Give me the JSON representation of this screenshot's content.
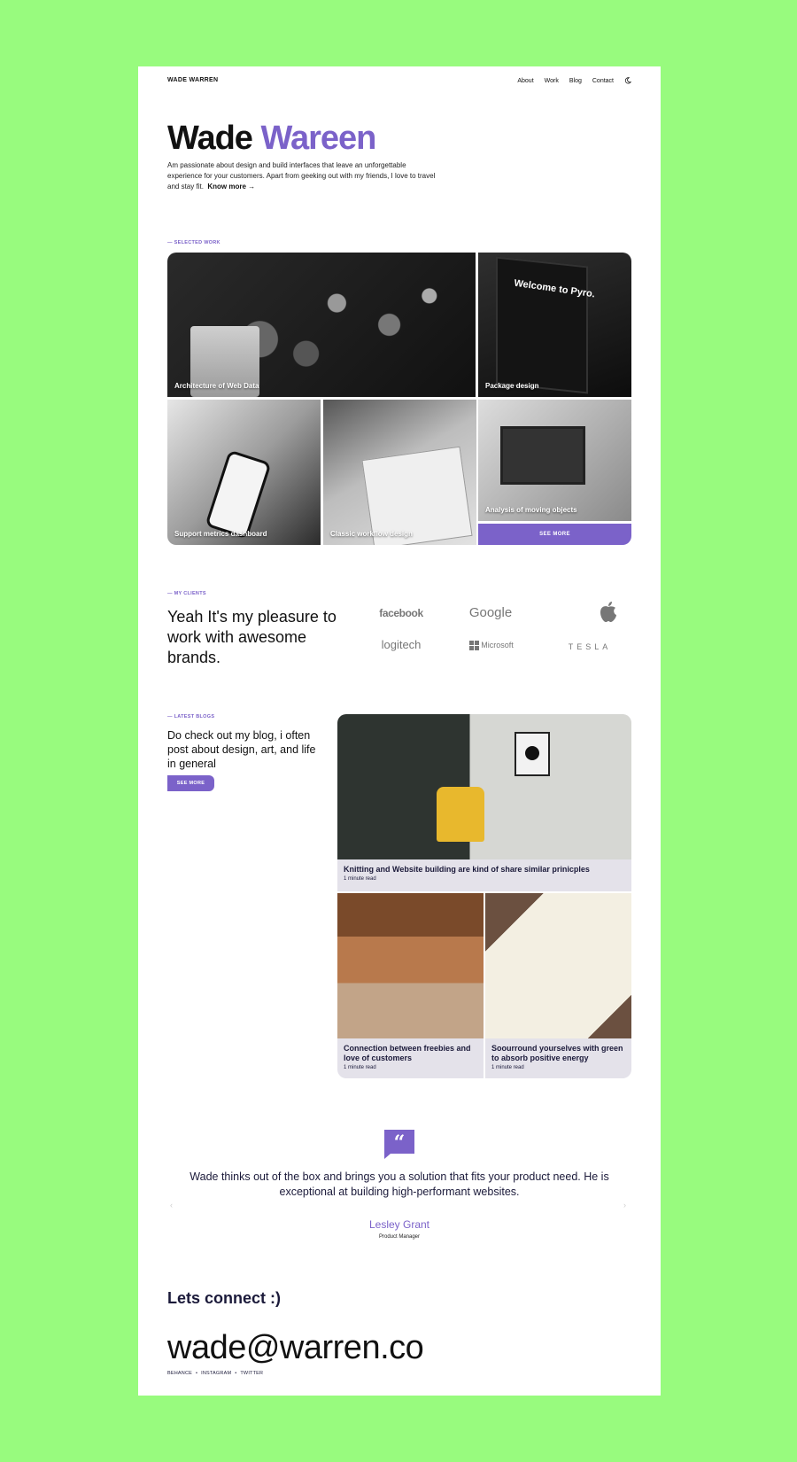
{
  "header": {
    "brand": "WADE WARREN",
    "nav": [
      "About",
      "Work",
      "Blog",
      "Contact"
    ],
    "theme_toggle_icon": "moon-icon"
  },
  "hero": {
    "first_name": "Wade",
    "last_name": "Wareen",
    "bio": "Am passionate about design and build interfaces that leave an unforgettable experience for your customers. Apart from geeking out with my friends, I love to travel and stay fit.",
    "know_more": "Know more →"
  },
  "work": {
    "label": "— SELECTED WORK",
    "items": [
      "Architecture of Web Data",
      "Package design",
      "Support metrics dashboard",
      "Classic workflow design",
      "Analysis of moving objects"
    ],
    "see_more": "SEE MORE",
    "pyro_screen_text": "Welcome to Pyro."
  },
  "clients": {
    "label": "— MY CLIENTS",
    "heading": "Yeah It's my pleasure to work with awesome brands.",
    "logos": [
      "facebook",
      "Google",
      "apple-logo-icon",
      "logitech",
      "Microsoft",
      "TESLA"
    ]
  },
  "blog": {
    "label": "— LATEST BLOGS",
    "heading": "Do check out my blog, i often post about design, art, and life in general",
    "see_more": "SEE MORE",
    "posts": [
      {
        "title": "Knitting and Website building are kind of share similar prinicples",
        "read": "1 minute read"
      },
      {
        "title": "Connection between freebies and love of customers",
        "read": "1 minute read"
      },
      {
        "title": "Soourround yourselves with green to absorb positive energy",
        "read": "1 minute read"
      }
    ]
  },
  "testimonial": {
    "quote_mark": "“",
    "text": "Wade thinks out of the box and brings you a solution that fits your product need. He is exceptional at building high-performant websites.",
    "author": "Lesley Grant",
    "role": "Product Manager",
    "prev": "‹",
    "next": "›"
  },
  "contact": {
    "heading": "Lets connect :)",
    "email": "wade@warren.co",
    "socials": [
      "BEHANCE",
      "INSTAGRAM",
      "TWITTER"
    ],
    "separator": "•"
  },
  "colors": {
    "background": "#98fb7e",
    "accent": "#7b62c9",
    "card": "#e4e2ea"
  }
}
